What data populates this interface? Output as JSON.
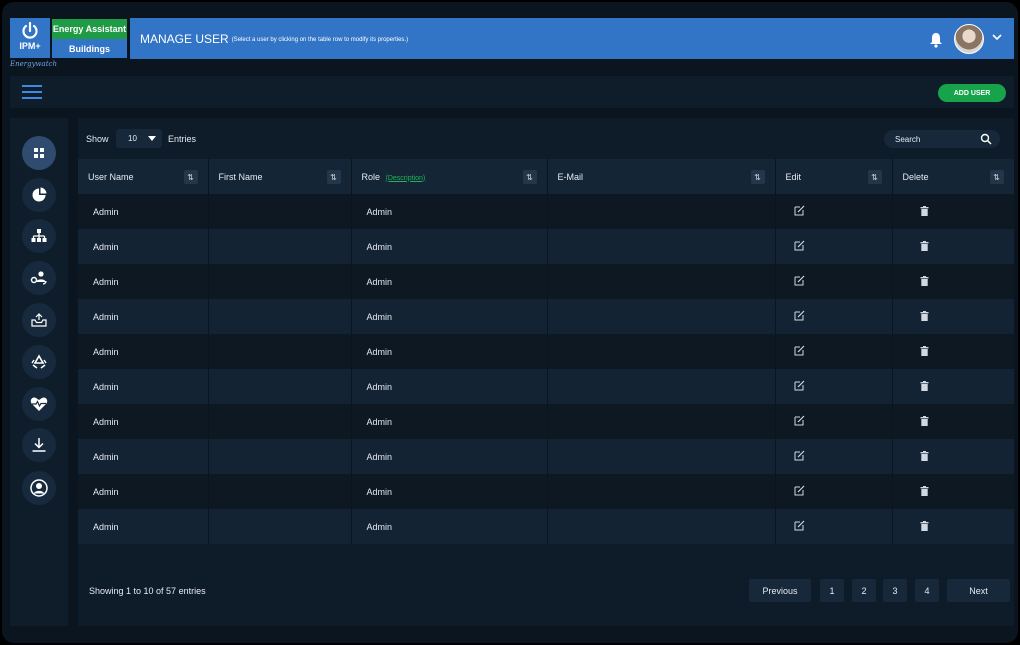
{
  "brand": {
    "logo_text": "IPM+",
    "script": "Energywatch",
    "badge_energy": "Energy Assistant",
    "badge_buildings": "Buildings"
  },
  "header": {
    "title": "MANAGE USER",
    "subtitle": "(Select a user by clicking on the table row to modify its properties.)"
  },
  "toolbar": {
    "add_user": "ADD USER"
  },
  "sidebar": {
    "items": [
      {
        "icon": "dashboard-icon",
        "active": true
      },
      {
        "icon": "pie-chart-icon"
      },
      {
        "icon": "hierarchy-icon"
      },
      {
        "icon": "users-settings-icon"
      },
      {
        "icon": "inbox-icon"
      },
      {
        "icon": "recycle-icon"
      },
      {
        "icon": "heartbeat-icon"
      },
      {
        "icon": "download-icon"
      },
      {
        "icon": "user-circle-icon"
      }
    ]
  },
  "controls": {
    "show_label": "Show",
    "page_size": "10",
    "entries_label": "Entries",
    "search_placeholder": "Search"
  },
  "table": {
    "columns": [
      {
        "label": "User Name"
      },
      {
        "label": "First Name"
      },
      {
        "label": "Role",
        "link": "(Description)"
      },
      {
        "label": "E-Mail"
      },
      {
        "label": "Edit"
      },
      {
        "label": "Delete"
      }
    ],
    "rows": [
      {
        "user_name": "Admin",
        "first_name": "",
        "role": "Admin",
        "email": ""
      },
      {
        "user_name": "Admin",
        "first_name": "",
        "role": "Admin",
        "email": ""
      },
      {
        "user_name": "Admin",
        "first_name": "",
        "role": "Admin",
        "email": ""
      },
      {
        "user_name": "Admin",
        "first_name": "",
        "role": "Admin",
        "email": ""
      },
      {
        "user_name": "Admin",
        "first_name": "",
        "role": "Admin",
        "email": ""
      },
      {
        "user_name": "Admin",
        "first_name": "",
        "role": "Admin",
        "email": ""
      },
      {
        "user_name": "Admin",
        "first_name": "",
        "role": "Admin",
        "email": ""
      },
      {
        "user_name": "Admin",
        "first_name": "",
        "role": "Admin",
        "email": ""
      },
      {
        "user_name": "Admin",
        "first_name": "",
        "role": "Admin",
        "email": ""
      },
      {
        "user_name": "Admin",
        "first_name": "",
        "role": "Admin",
        "email": ""
      }
    ]
  },
  "footer": {
    "info": "Showing 1 to 10 of 57 entries",
    "previous": "Previous",
    "pages": [
      "1",
      "2",
      "3",
      "4"
    ],
    "next": "Next"
  },
  "colors": {
    "header_blue": "#3274c6",
    "accent_green": "#1f9b45",
    "link_green": "#1fb35a",
    "background": "#0b1520"
  }
}
